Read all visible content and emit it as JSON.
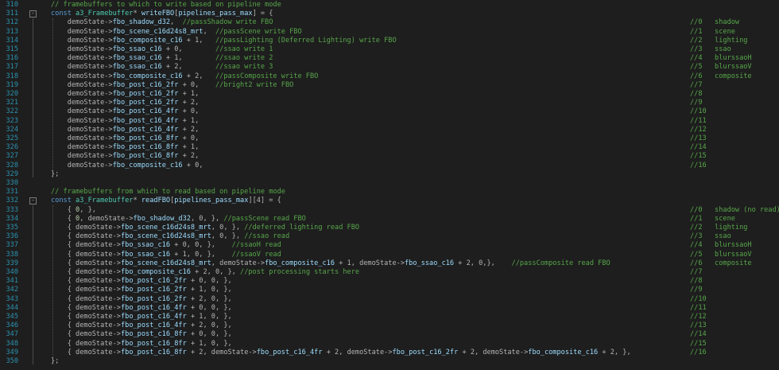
{
  "colors": {
    "background": "#1e1e1e",
    "line_number": "#2b91af",
    "keyword": "#569cd6",
    "type": "#4ec9b0",
    "identifier": "#9cdcfe",
    "comment": "#57a64a",
    "number": "#b5cea8",
    "text": "#dcdcdc"
  },
  "lines": [
    {
      "no": "310",
      "segs": [
        {
          "c": "c",
          "t": "// framebuffers to which to write based on pipeline mode"
        }
      ],
      "right": ""
    },
    {
      "no": "311",
      "fold": "-",
      "segs": [
        {
          "c": "k",
          "t": "const "
        },
        {
          "c": "t",
          "t": "a3_Framebuffer"
        },
        {
          "c": "p",
          "t": "* "
        },
        {
          "c": "v",
          "t": "writeFBO"
        },
        {
          "c": "p",
          "t": "["
        },
        {
          "c": "v",
          "t": "pipelines_pass_max"
        },
        {
          "c": "p",
          "t": "] = {"
        }
      ],
      "right": ""
    },
    {
      "no": "312",
      "segs": [
        {
          "c": "p",
          "t": "    demoState->"
        },
        {
          "c": "v",
          "t": "fbo_shadow_d32"
        },
        {
          "c": "p",
          "t": ",  "
        },
        {
          "c": "c",
          "t": "//passShadow write FBO"
        }
      ],
      "right": "//0   shadow"
    },
    {
      "no": "313",
      "segs": [
        {
          "c": "p",
          "t": "    demoState->"
        },
        {
          "c": "v",
          "t": "fbo_scene_c16d24s8_mrt"
        },
        {
          "c": "p",
          "t": ",  "
        },
        {
          "c": "c",
          "t": "//passScene write FBO"
        }
      ],
      "right": "//1   scene"
    },
    {
      "no": "314",
      "segs": [
        {
          "c": "p",
          "t": "    demoState->"
        },
        {
          "c": "v",
          "t": "fbo_composite_c16"
        },
        {
          "c": "p",
          "t": " + 1,   "
        },
        {
          "c": "c",
          "t": "//passLighting (Deferred Lighting) write FBO"
        }
      ],
      "right": "//2   lighting"
    },
    {
      "no": "315",
      "segs": [
        {
          "c": "p",
          "t": "    demoState->"
        },
        {
          "c": "v",
          "t": "fbo_ssao_c16"
        },
        {
          "c": "p",
          "t": " + 0,        "
        },
        {
          "c": "c",
          "t": "//ssao write 1"
        }
      ],
      "right": "//3   ssao"
    },
    {
      "no": "316",
      "segs": [
        {
          "c": "p",
          "t": "    demoState->"
        },
        {
          "c": "v",
          "t": "fbo_ssao_c16"
        },
        {
          "c": "p",
          "t": " + 1,        "
        },
        {
          "c": "c",
          "t": "//ssao write 2"
        }
      ],
      "right": "//4   blurssaoH"
    },
    {
      "no": "317",
      "segs": [
        {
          "c": "p",
          "t": "    demoState->"
        },
        {
          "c": "v",
          "t": "fbo_ssao_c16"
        },
        {
          "c": "p",
          "t": " + 2,        "
        },
        {
          "c": "c",
          "t": "//ssao write 3"
        }
      ],
      "right": "//5   blurssaoV"
    },
    {
      "no": "318",
      "segs": [
        {
          "c": "p",
          "t": "    demoState->"
        },
        {
          "c": "v",
          "t": "fbo_composite_c16"
        },
        {
          "c": "p",
          "t": " + 2,   "
        },
        {
          "c": "c",
          "t": "//passComposite write FBO"
        }
      ],
      "right": "//6   composite"
    },
    {
      "no": "319",
      "segs": [
        {
          "c": "p",
          "t": "    demoState->"
        },
        {
          "c": "v",
          "t": "fbo_post_c16_2fr"
        },
        {
          "c": "p",
          "t": " + 0,    "
        },
        {
          "c": "c",
          "t": "//bright2 write FBO"
        }
      ],
      "right": "//7"
    },
    {
      "no": "320",
      "segs": [
        {
          "c": "p",
          "t": "    demoState->"
        },
        {
          "c": "v",
          "t": "fbo_post_c16_2fr"
        },
        {
          "c": "p",
          "t": " + 1,"
        }
      ],
      "right": "//8"
    },
    {
      "no": "321",
      "segs": [
        {
          "c": "p",
          "t": "    demoState->"
        },
        {
          "c": "v",
          "t": "fbo_post_c16_2fr"
        },
        {
          "c": "p",
          "t": " + 2,"
        }
      ],
      "right": "//9"
    },
    {
      "no": "322",
      "segs": [
        {
          "c": "p",
          "t": "    demoState->"
        },
        {
          "c": "v",
          "t": "fbo_post_c16_4fr"
        },
        {
          "c": "p",
          "t": " + 0,"
        }
      ],
      "right": "//10"
    },
    {
      "no": "323",
      "segs": [
        {
          "c": "p",
          "t": "    demoState->"
        },
        {
          "c": "v",
          "t": "fbo_post_c16_4fr"
        },
        {
          "c": "p",
          "t": " + 1,"
        }
      ],
      "right": "//11"
    },
    {
      "no": "324",
      "segs": [
        {
          "c": "p",
          "t": "    demoState->"
        },
        {
          "c": "v",
          "t": "fbo_post_c16_4fr"
        },
        {
          "c": "p",
          "t": " + 2,"
        }
      ],
      "right": "//12"
    },
    {
      "no": "325",
      "segs": [
        {
          "c": "p",
          "t": "    demoState->"
        },
        {
          "c": "v",
          "t": "fbo_post_c16_8fr"
        },
        {
          "c": "p",
          "t": " + 0,"
        }
      ],
      "right": "//13"
    },
    {
      "no": "326",
      "segs": [
        {
          "c": "p",
          "t": "    demoState->"
        },
        {
          "c": "v",
          "t": "fbo_post_c16_8fr"
        },
        {
          "c": "p",
          "t": " + 1,"
        }
      ],
      "right": "//14"
    },
    {
      "no": "327",
      "segs": [
        {
          "c": "p",
          "t": "    demoState->"
        },
        {
          "c": "v",
          "t": "fbo_post_c16_8fr"
        },
        {
          "c": "p",
          "t": " + 2,"
        }
      ],
      "right": "//15"
    },
    {
      "no": "328",
      "segs": [
        {
          "c": "p",
          "t": "    demoState->"
        },
        {
          "c": "v",
          "t": "fbo_composite_c16"
        },
        {
          "c": "p",
          "t": " + 0,"
        }
      ],
      "right": "//16"
    },
    {
      "no": "329",
      "segs": [
        {
          "c": "p",
          "t": "};"
        }
      ],
      "right": ""
    },
    {
      "no": "330",
      "segs": [],
      "right": ""
    },
    {
      "no": "331",
      "segs": [
        {
          "c": "c",
          "t": "// framebuffers from which to read based on pipeline mode"
        }
      ],
      "right": ""
    },
    {
      "no": "332",
      "fold": "-",
      "segs": [
        {
          "c": "k",
          "t": "const "
        },
        {
          "c": "t",
          "t": "a3_Framebuffer"
        },
        {
          "c": "p",
          "t": "* "
        },
        {
          "c": "v",
          "t": "readFBO"
        },
        {
          "c": "p",
          "t": "["
        },
        {
          "c": "v",
          "t": "pipelines_pass_max"
        },
        {
          "c": "p",
          "t": "][4] = {"
        }
      ],
      "right": ""
    },
    {
      "no": "333",
      "segs": [
        {
          "c": "p",
          "t": "    { "
        },
        {
          "c": "n",
          "t": "0"
        },
        {
          "c": "p",
          "t": ", },"
        }
      ],
      "right": "//0   shadow (no read)"
    },
    {
      "no": "334",
      "segs": [
        {
          "c": "p",
          "t": "    { "
        },
        {
          "c": "n",
          "t": "0"
        },
        {
          "c": "p",
          "t": ", demoState->"
        },
        {
          "c": "v",
          "t": "fbo_shadow_d32"
        },
        {
          "c": "p",
          "t": ", 0, }, "
        },
        {
          "c": "c",
          "t": "//passScene read FBO"
        }
      ],
      "right": "//1   scene"
    },
    {
      "no": "335",
      "segs": [
        {
          "c": "p",
          "t": "    { demoState->"
        },
        {
          "c": "v",
          "t": "fbo_scene_c16d24s8_mrt"
        },
        {
          "c": "p",
          "t": ", 0, }, "
        },
        {
          "c": "c",
          "t": "//deferred lighting read FBO"
        }
      ],
      "right": "//2   lighting"
    },
    {
      "no": "336",
      "segs": [
        {
          "c": "p",
          "t": "    { demoState->"
        },
        {
          "c": "v",
          "t": "fbo_scene_c16d24s8_mrt"
        },
        {
          "c": "p",
          "t": ", 0, }, "
        },
        {
          "c": "c",
          "t": "//ssao read"
        }
      ],
      "right": "//3   ssao"
    },
    {
      "no": "337",
      "segs": [
        {
          "c": "p",
          "t": "    { demoState->"
        },
        {
          "c": "v",
          "t": "fbo_ssao_c16"
        },
        {
          "c": "p",
          "t": " + 0, 0, },    "
        },
        {
          "c": "c",
          "t": "//ssaoH read"
        }
      ],
      "right": "//4   blurssaoH"
    },
    {
      "no": "338",
      "segs": [
        {
          "c": "p",
          "t": "    { demoState->"
        },
        {
          "c": "v",
          "t": "fbo_ssao_c16"
        },
        {
          "c": "p",
          "t": " + 1, 0, },    "
        },
        {
          "c": "c",
          "t": "//ssaoV read"
        }
      ],
      "right": "//5   blurssaoV"
    },
    {
      "no": "339",
      "segs": [
        {
          "c": "p",
          "t": "    { demoState->"
        },
        {
          "c": "v",
          "t": "fbo_scene_c16d24s8_mrt"
        },
        {
          "c": "p",
          "t": ", demoState->"
        },
        {
          "c": "v",
          "t": "fbo_composite_c16"
        },
        {
          "c": "p",
          "t": " + 1, demoState->"
        },
        {
          "c": "v",
          "t": "fbo_ssao_c16"
        },
        {
          "c": "p",
          "t": " + 2, 0,},    "
        },
        {
          "c": "c",
          "t": "//passComposite read FBO"
        }
      ],
      "right": "//6   composite"
    },
    {
      "no": "340",
      "segs": [
        {
          "c": "p",
          "t": "    { demoState->"
        },
        {
          "c": "v",
          "t": "fbo_composite_c16"
        },
        {
          "c": "p",
          "t": " + 2, 0, }, "
        },
        {
          "c": "c",
          "t": "//post processing starts here"
        }
      ],
      "right": "//7"
    },
    {
      "no": "341",
      "segs": [
        {
          "c": "p",
          "t": "    { demoState->"
        },
        {
          "c": "v",
          "t": "fbo_post_c16_2fr"
        },
        {
          "c": "p",
          "t": " + 0, 0, },"
        }
      ],
      "right": "//8"
    },
    {
      "no": "342",
      "segs": [
        {
          "c": "p",
          "t": "    { demoState->"
        },
        {
          "c": "v",
          "t": "fbo_post_c16_2fr"
        },
        {
          "c": "p",
          "t": " + 1, 0, },"
        }
      ],
      "right": "//9"
    },
    {
      "no": "343",
      "segs": [
        {
          "c": "p",
          "t": "    { demoState->"
        },
        {
          "c": "v",
          "t": "fbo_post_c16_2fr"
        },
        {
          "c": "p",
          "t": " + 2, 0, },"
        }
      ],
      "right": "//10"
    },
    {
      "no": "344",
      "segs": [
        {
          "c": "p",
          "t": "    { demoState->"
        },
        {
          "c": "v",
          "t": "fbo_post_c16_4fr"
        },
        {
          "c": "p",
          "t": " + 0, 0, },"
        }
      ],
      "right": "//11"
    },
    {
      "no": "345",
      "segs": [
        {
          "c": "p",
          "t": "    { demoState->"
        },
        {
          "c": "v",
          "t": "fbo_post_c16_4fr"
        },
        {
          "c": "p",
          "t": " + 1, 0, },"
        }
      ],
      "right": "//12"
    },
    {
      "no": "346",
      "segs": [
        {
          "c": "p",
          "t": "    { demoState->"
        },
        {
          "c": "v",
          "t": "fbo_post_c16_4fr"
        },
        {
          "c": "p",
          "t": " + 2, 0, },"
        }
      ],
      "right": "//13"
    },
    {
      "no": "347",
      "segs": [
        {
          "c": "p",
          "t": "    { demoState->"
        },
        {
          "c": "v",
          "t": "fbo_post_c16_8fr"
        },
        {
          "c": "p",
          "t": " + 0, 0, },"
        }
      ],
      "right": "//14"
    },
    {
      "no": "348",
      "segs": [
        {
          "c": "p",
          "t": "    { demoState->"
        },
        {
          "c": "v",
          "t": "fbo_post_c16_8fr"
        },
        {
          "c": "p",
          "t": " + 1, 0, },"
        }
      ],
      "right": "//15"
    },
    {
      "no": "349",
      "segs": [
        {
          "c": "p",
          "t": "    { demoState->"
        },
        {
          "c": "v",
          "t": "fbo_post_c16_8fr"
        },
        {
          "c": "p",
          "t": " + 2, demoState->"
        },
        {
          "c": "v",
          "t": "fbo_post_c16_4fr"
        },
        {
          "c": "p",
          "t": " + 2, demoState->"
        },
        {
          "c": "v",
          "t": "fbo_post_c16_2fr"
        },
        {
          "c": "p",
          "t": " + 2, demoState->"
        },
        {
          "c": "v",
          "t": "fbo_composite_c16"
        },
        {
          "c": "p",
          "t": " + 2, },"
        }
      ],
      "right": "//16"
    },
    {
      "no": "350",
      "segs": [
        {
          "c": "p",
          "t": "};"
        }
      ],
      "right": ""
    }
  ]
}
